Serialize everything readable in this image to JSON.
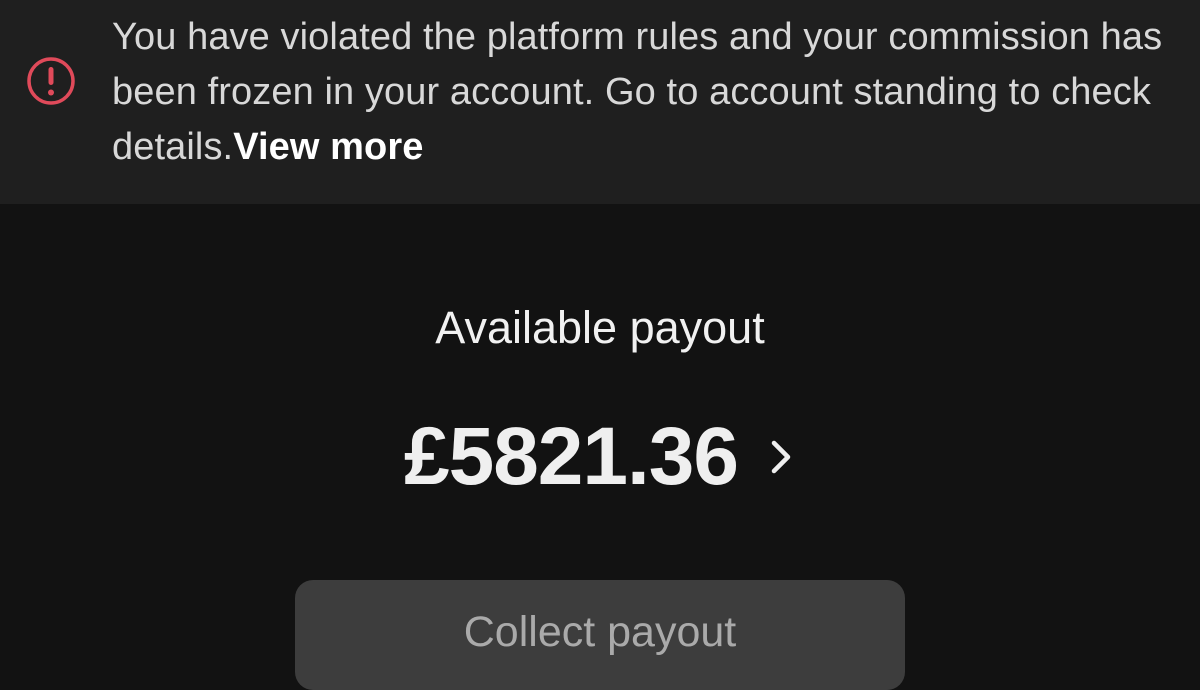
{
  "notice": {
    "icon": "warning-circle-icon",
    "icon_color": "#e04a5a",
    "message": "You have violated the platform rules and your commission has been frozen in your account. Go to account standing to check details.",
    "link_text": "View more"
  },
  "payout": {
    "title": "Available payout",
    "amount": "£5821.36",
    "chevron_icon": "chevron-right-icon",
    "button_label": "Collect payout"
  }
}
